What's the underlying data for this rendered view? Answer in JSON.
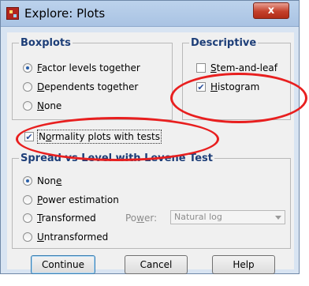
{
  "window": {
    "title": "Explore: Plots",
    "close_label": "x"
  },
  "boxplots": {
    "legend": "Boxplots",
    "options": [
      {
        "label_pre": "",
        "label_key": "F",
        "label_post": "actor levels together",
        "selected": true
      },
      {
        "label_pre": "",
        "label_key": "D",
        "label_post": "ependents together",
        "selected": false
      },
      {
        "label_pre": "",
        "label_key": "N",
        "label_post": "one",
        "selected": false
      }
    ]
  },
  "descriptive": {
    "legend": "Descriptive",
    "stem_and_leaf": {
      "label_pre": "",
      "label_key": "S",
      "label_post": "tem-and-leaf",
      "checked": false
    },
    "histogram": {
      "label_pre": "",
      "label_key": "H",
      "label_post": "istogram",
      "checked": true
    }
  },
  "normality": {
    "label_pre": "N",
    "label_key": "o",
    "label_post": "rmality plots with tests",
    "checked": true
  },
  "spread": {
    "legend": "Spread vs Level with Levene Test",
    "options": [
      {
        "label_pre": "Non",
        "label_key": "e",
        "label_post": "",
        "selected": true
      },
      {
        "label_pre": "",
        "label_key": "P",
        "label_post": "ower estimation",
        "selected": false
      },
      {
        "label_pre": "",
        "label_key": "T",
        "label_post": "ransformed",
        "selected": false
      },
      {
        "label_pre": "",
        "label_key": "U",
        "label_post": "ntransformed",
        "selected": false
      }
    ],
    "power_label_pre": "Po",
    "power_label_key": "w",
    "power_label_post": "er:",
    "power_value": "Natural log"
  },
  "buttons": {
    "continue": "Continue",
    "cancel": "Cancel",
    "help": "Help"
  },
  "colors": {
    "annotation": "#e81f1f",
    "legend_text": "#1d3e78",
    "dialog_bg": "#f0f0f0"
  }
}
